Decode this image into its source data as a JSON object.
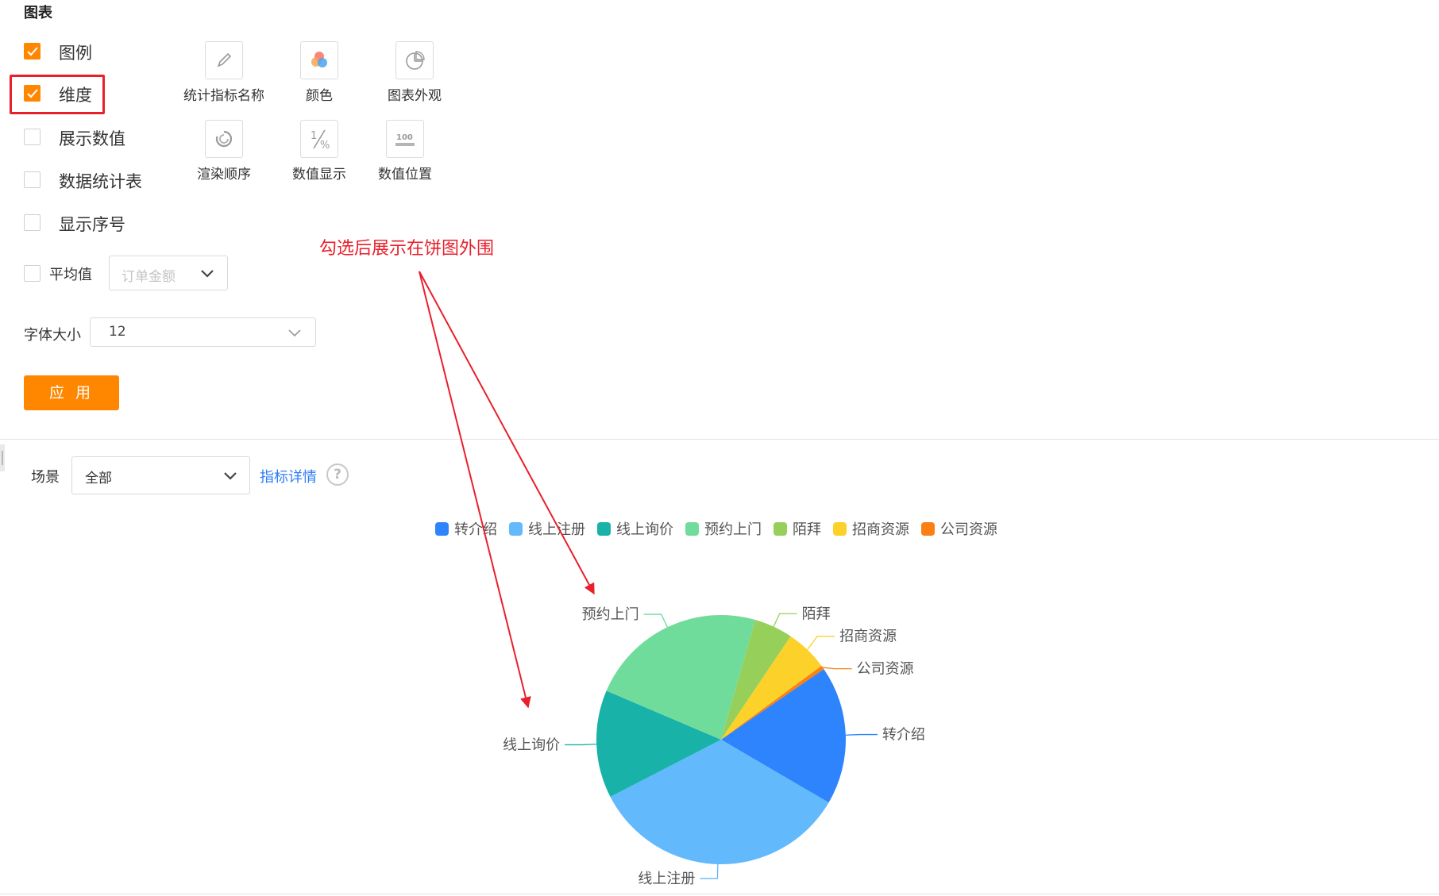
{
  "panel": {
    "title": "图表",
    "checkboxes": [
      {
        "label": "图例",
        "checked": true
      },
      {
        "label": "维度",
        "checked": true
      },
      {
        "label": "展示数值",
        "checked": false
      },
      {
        "label": "数据统计表",
        "checked": false
      },
      {
        "label": "显示序号",
        "checked": false
      }
    ],
    "tools": [
      {
        "label": "统计指标名称",
        "icon": "pencil-icon"
      },
      {
        "label": "颜色",
        "icon": "color-palette-icon"
      },
      {
        "label": "图表外观",
        "icon": "pie-chart-icon"
      },
      {
        "label": "渲染顺序",
        "icon": "render-order-icon"
      },
      {
        "label": "数值显示",
        "icon": "percent-icon"
      },
      {
        "label": "数值位置",
        "icon": "value-position-icon"
      }
    ],
    "average": {
      "label": "平均值",
      "checked": false,
      "placeholder": "订单金额"
    },
    "font_size": {
      "label": "字体大小",
      "value": "12"
    },
    "apply_label": "应 用"
  },
  "filter": {
    "scene_label": "场景",
    "scene_value": "全部",
    "detail_link": "指标详情",
    "help_glyph": "?"
  },
  "annotation": "勾选后展示在饼图外围",
  "colors": {
    "accent": "#ff8700",
    "highlight": "#e8202c",
    "link": "#2f7cf6"
  },
  "chart_data": {
    "type": "pie",
    "legend_position": "top",
    "labels_outside": true,
    "slices": [
      {
        "name": "转介绍",
        "value": 18,
        "color": "#2e84fc"
      },
      {
        "name": "线上注册",
        "value": 34,
        "color": "#62b9fc"
      },
      {
        "name": "线上询价",
        "value": 14,
        "color": "#18b2a8"
      },
      {
        "name": "预约上门",
        "value": 23,
        "color": "#70dc9c"
      },
      {
        "name": "陌拜",
        "value": 5,
        "color": "#96d05a"
      },
      {
        "name": "招商资源",
        "value": 5.5,
        "color": "#fbd12a"
      },
      {
        "name": "公司资源",
        "value": 0.5,
        "color": "#fc7f13"
      }
    ]
  }
}
